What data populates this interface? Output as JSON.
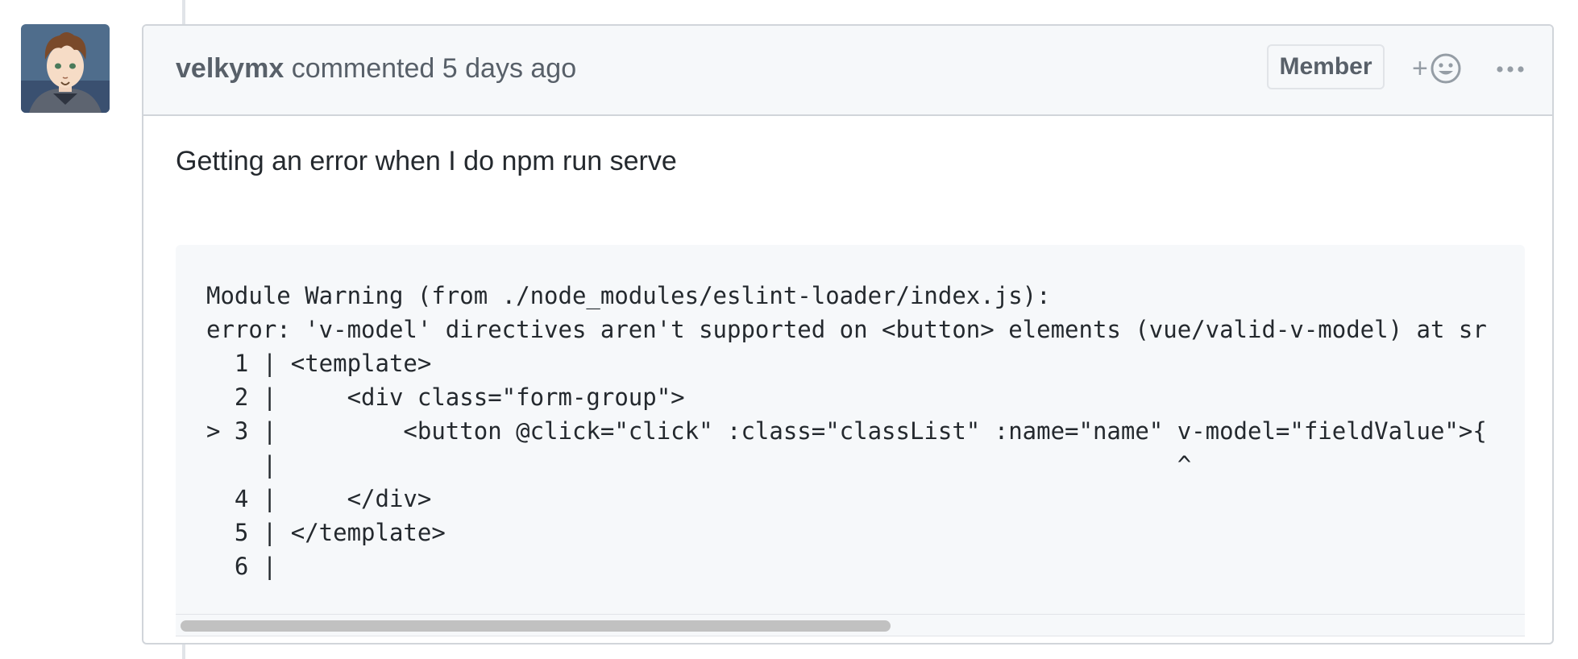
{
  "comment": {
    "author": "velkymx",
    "action": "commented",
    "time": "5 days ago",
    "badge": "Member",
    "reaction_plus": "+",
    "reaction_icon": "smiley-icon",
    "more_icon": "kebab-horizontal-icon",
    "body_text": "Getting an error when I do npm run serve",
    "code_lines": [
      "Module Warning (from ./node_modules/eslint-loader/index.js):",
      "error: 'v-model' directives aren't supported on <button> elements (vue/valid-v-model) at sr",
      "  1 | <template>",
      "  2 |     <div class=\"form-group\">",
      "> 3 |         <button @click=\"click\" :class=\"classList\" :name=\"name\" v-model=\"fieldValue\">{",
      "    |                                                                ^",
      "  4 |     </div>",
      "  5 | </template>",
      "  6 |"
    ],
    "scroll_position_fraction": 0.53
  },
  "colors": {
    "header_bg": "#f6f8fa",
    "border": "#d1d5da",
    "muted_text": "#586069",
    "code_bg": "#f6f8fa",
    "scroll_thumb": "#c1c1c1"
  }
}
